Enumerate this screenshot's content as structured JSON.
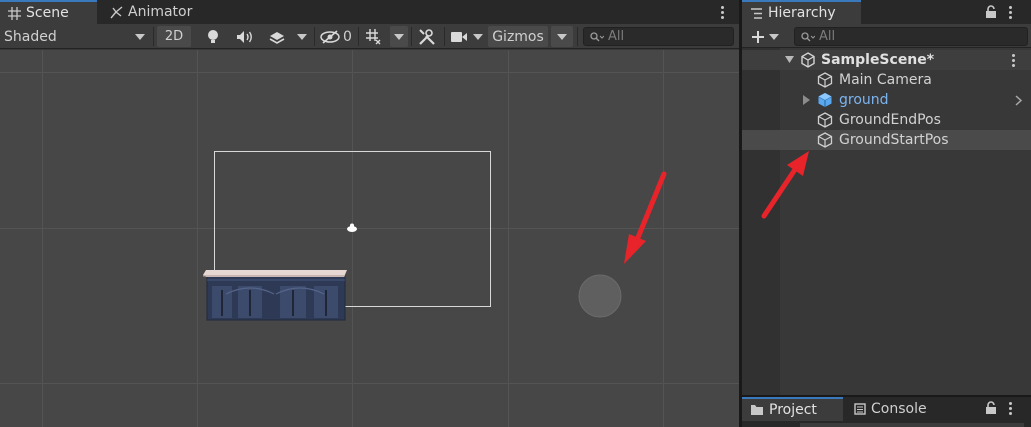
{
  "scene_view": {
    "tabs": [
      {
        "label": "Scene",
        "active": true
      },
      {
        "label": "Animator",
        "active": false
      }
    ],
    "toolbar": {
      "shading_mode": "Shaded",
      "mode_2d": "2D",
      "hidden_count": "0",
      "gizmos_label": "Gizmos",
      "search_placeholder": "All"
    }
  },
  "hierarchy": {
    "tab_label": "Hierarchy",
    "search_placeholder": "All",
    "scene_name": "SampleScene*",
    "items": [
      {
        "label": "Main Camera",
        "has_children": false,
        "is_prefab": false,
        "selected": false
      },
      {
        "label": "ground",
        "has_children": true,
        "is_prefab": true,
        "selected": false
      },
      {
        "label": "GroundEndPos",
        "has_children": false,
        "is_prefab": false,
        "selected": false
      },
      {
        "label": "GroundStartPos",
        "has_children": false,
        "is_prefab": false,
        "selected": true
      }
    ]
  },
  "bottom_tabs": [
    {
      "label": "Project",
      "active": true
    },
    {
      "label": "Console",
      "active": false
    }
  ],
  "colors": {
    "accent_tab": "#3a79bb",
    "prefab_text": "#7cb4f0",
    "annotation_arrow": "#e8242a"
  },
  "icons": [
    "scene-grid-icon",
    "animator-icon",
    "lightbulb-icon",
    "audio-icon",
    "effects-icon",
    "visibility-icon",
    "grid-snap-icon",
    "tools-icon",
    "camera-icon",
    "search-icon",
    "lock-icon",
    "kebab-menu-icon",
    "plus-icon",
    "unity-logo-icon",
    "gameobject-cube-icon",
    "prefab-cube-icon",
    "folder-icon",
    "console-icon"
  ]
}
